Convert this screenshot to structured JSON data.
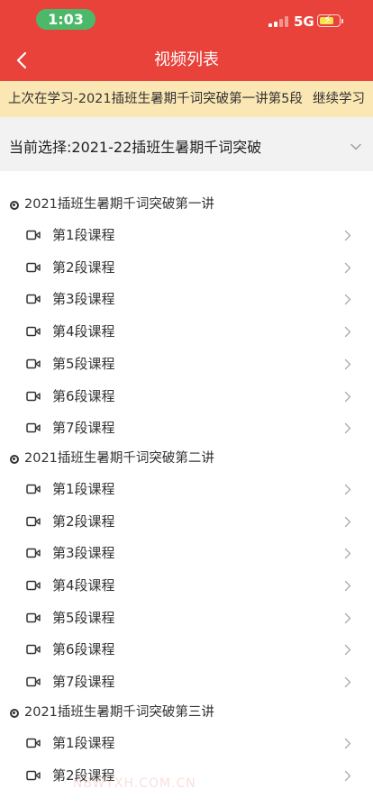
{
  "status_bar": {
    "time": "1:03",
    "network": "5G"
  },
  "header": {
    "title": "视频列表",
    "back_icon": "chevron-left-icon"
  },
  "resume_banner": {
    "text": "上次在学习-2021插班生暑期千词突破第一讲第5段",
    "action": "继续学习"
  },
  "selector": {
    "label": "当前选择:2021-22插班生暑期千词突破",
    "icon": "chevron-down-icon"
  },
  "sections": [
    {
      "title": "2021插班生暑期千词突破第一讲",
      "lessons": [
        "第1段课程",
        "第2段课程",
        "第3段课程",
        "第4段课程",
        "第5段课程",
        "第6段课程",
        "第7段课程"
      ]
    },
    {
      "title": "2021插班生暑期千词突破第二讲",
      "lessons": [
        "第1段课程",
        "第2段课程",
        "第3段课程",
        "第4段课程",
        "第5段课程",
        "第6段课程",
        "第7段课程"
      ]
    },
    {
      "title": "2021插班生暑期千词突破第三讲",
      "lessons": [
        "第1段课程",
        "第2段课程"
      ]
    }
  ],
  "watermark": "· NBWYXH.COM.CN",
  "colors": {
    "header": "#e8423a",
    "banner": "#fbe7b4",
    "time_pill": "#4cb96a"
  }
}
